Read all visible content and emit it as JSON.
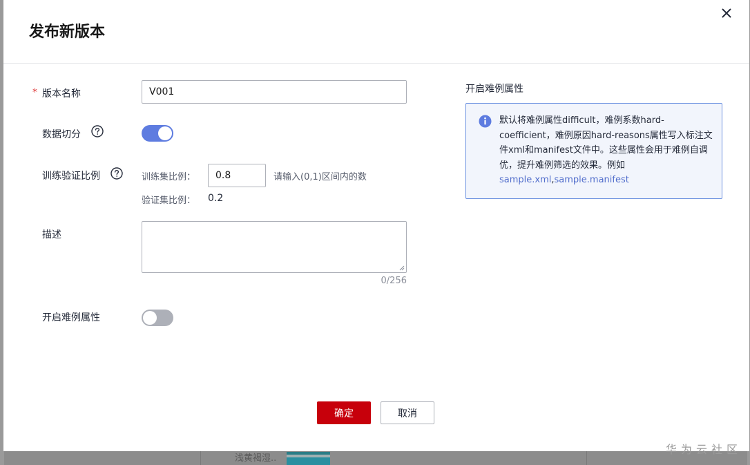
{
  "modal": {
    "title": "发布新版本",
    "close_icon": "close-icon"
  },
  "form": {
    "version_name": {
      "required_mark": "*",
      "label": "版本名称",
      "value": "V001"
    },
    "data_split": {
      "label": "数据切分",
      "help_icon": "question-circle-icon",
      "toggle_on": true
    },
    "train_val_ratio": {
      "label": "训练验证比例",
      "help_icon": "question-circle-icon",
      "train_label": "训练集比例：",
      "train_value": "0.8",
      "hint": "请输入(0,1)区间内的数",
      "val_label": "验证集比例：",
      "val_value": "0.2"
    },
    "description": {
      "label": "描述",
      "value": "",
      "char_count": "0/256"
    },
    "hard_example": {
      "label": "开启难例属性",
      "toggle_on": false
    }
  },
  "side_panel": {
    "title": "开启难例属性",
    "info_icon": "info-icon",
    "info_text": "默认将难例属性difficult，难例系数hard-coefficient，难例原因hard-reasons属性写入标注文件xml和manifest文件中。这些属性会用于难例自调优，提升难例筛选的效果。例如",
    "link_xml": "sample.xml",
    "link_sep": ",",
    "link_manifest": "sample.manifest"
  },
  "buttons": {
    "confirm": "确定",
    "cancel": "取消"
  },
  "background": {
    "row_text": "浅黄褐湿.."
  },
  "watermark": "华为云社区",
  "colors": {
    "primary_button": "#c7000b",
    "toggle_on": "#5e7ce0",
    "toggle_off": "#adb0b8",
    "info_border": "#6b90e0",
    "link": "#526ecc",
    "required": "#e04040"
  }
}
